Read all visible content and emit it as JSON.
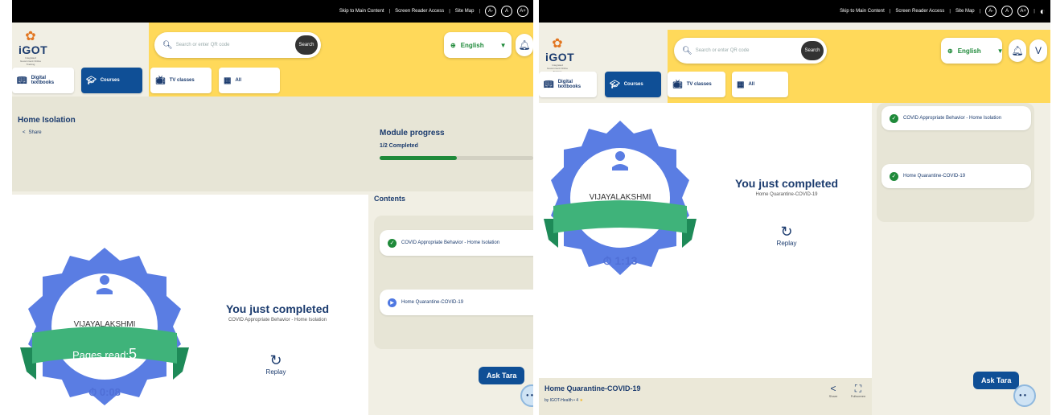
{
  "top_links": {
    "skip": "Skip to Main Content",
    "screen_reader": "Screen Reader Access",
    "site_map": "Site Map",
    "font_small": "A-",
    "font_normal": "A",
    "font_large": "A+"
  },
  "logo": {
    "text": "iGOT",
    "tag": "Integrated Government Online Training"
  },
  "search": {
    "placeholder": "Search or enter QR code",
    "button": "Search"
  },
  "language": {
    "selected": "English"
  },
  "user": {
    "initial": "V"
  },
  "nav": [
    {
      "label": "Digital textbooks",
      "icon": "book-icon"
    },
    {
      "label": "Courses",
      "icon": "graduation-cap-icon",
      "active": true
    },
    {
      "label": "TV classes",
      "icon": "tv-icon"
    },
    {
      "label": "All",
      "icon": "all-icon"
    }
  ],
  "page": {
    "title": "Home Isolation",
    "share": "Share",
    "progress_label": "Module progress",
    "progress_value": "1/2 Completed",
    "progress_fraction": 0.5
  },
  "completion_left": {
    "name": "VIJAYALAKSHMI",
    "pages_read_label": "Pages read:",
    "pages_read_value": "5",
    "time": "0:08",
    "heading": "You just completed",
    "subtitle": "COVID Appropriate Behavior - Home Isolation",
    "replay": "Replay"
  },
  "completion_right": {
    "name": "VIJAYALAKSHMI",
    "time": "1:13",
    "heading": "You just completed",
    "subtitle": "Home Quarantine-COVID-19",
    "replay": "Replay"
  },
  "contents": {
    "heading": "Contents",
    "items": [
      {
        "label": "COVID Appropriate Behavior - Home Isolation",
        "status": "completed"
      },
      {
        "label": "Home Quarantine-COVID-19",
        "status": "playing"
      }
    ],
    "items_right": [
      {
        "label": "COVID Appropriate Behavior - Home Isolation",
        "status": "completed"
      },
      {
        "label": "Home Quarantine-COVID-19",
        "status": "completed"
      }
    ]
  },
  "assistant": {
    "label": "Ask Tara"
  },
  "player": {
    "title": "Home Quarantine-COVID-19",
    "by": "by IGOT-Health",
    "rating": "4",
    "share": "Share",
    "fullscreen": "Fullscreen"
  },
  "colors": {
    "yellow": "#ffd95a",
    "navy": "#1b3b6e",
    "blue_active": "#0f4f96",
    "green": "#1f8a3a",
    "badge_blue": "#5a7de3",
    "ribbon_green": "#3fb37a"
  }
}
